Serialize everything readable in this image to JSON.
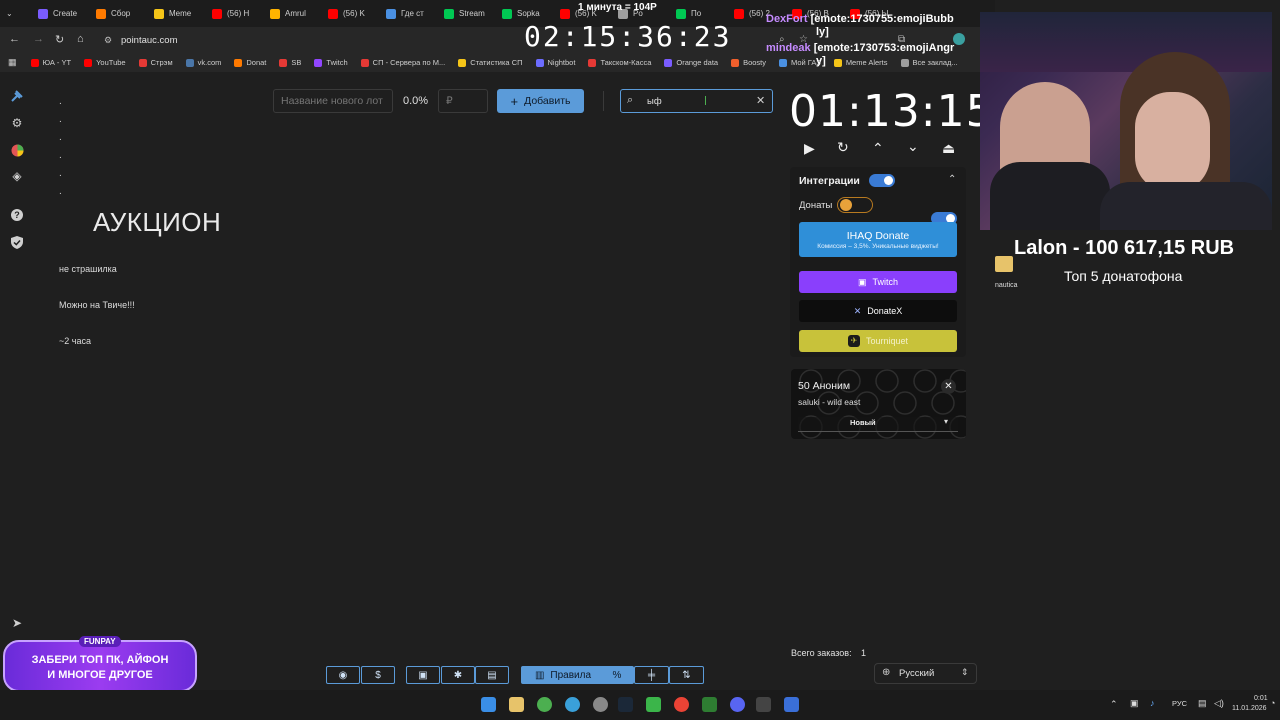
{
  "browser": {
    "tabs": [
      {
        "label": "Create",
        "color": "#7a5cff"
      },
      {
        "label": "Сбор",
        "color": "#ff7a00"
      },
      {
        "label": "Meme",
        "color": "#f5c518"
      },
      {
        "label": "(56) H",
        "color": "#ff0000"
      },
      {
        "label": "Amrul",
        "color": "#ffb300"
      },
      {
        "label": "(56) K",
        "color": "#ff0000"
      },
      {
        "label": "Где ст",
        "color": "#4a90e2"
      },
      {
        "label": "Stream",
        "color": "#00c853"
      },
      {
        "label": "Sopka",
        "color": "#00c853"
      },
      {
        "label": "(56) K",
        "color": "#ff0000"
      },
      {
        "label": "Po",
        "color": "#9e9e9e"
      },
      {
        "label": "По",
        "color": "#00c853"
      },
      {
        "label": "(56) 2",
        "color": "#ff0000"
      },
      {
        "label": "(56) B",
        "color": "#ff0000"
      },
      {
        "label": "(56) Ы",
        "color": "#ff0000"
      }
    ],
    "url": "pointauc.com",
    "bookmarks": [
      {
        "label": "ЮА - YT",
        "color": "#ff0000"
      },
      {
        "label": "YouTube",
        "color": "#ff0000"
      },
      {
        "label": "Стрэм",
        "color": "#e53935"
      },
      {
        "label": "vk.com",
        "color": "#4a76a8"
      },
      {
        "label": "Donat",
        "color": "#ff7a00"
      },
      {
        "label": "SB",
        "color": "#e53935"
      },
      {
        "label": "Twitch",
        "color": "#9146ff"
      },
      {
        "label": "СП - Сервера по M...",
        "color": "#e53935"
      },
      {
        "label": "Статистика СП",
        "color": "#f5c518"
      },
      {
        "label": "Nightbot",
        "color": "#6c6cff"
      },
      {
        "label": "Такском-Касса",
        "color": "#e53935"
      },
      {
        "label": "Orange data",
        "color": "#7a5cff"
      },
      {
        "label": "Boosty",
        "color": "#f15f2c"
      },
      {
        "label": "Мой ГАЗ",
        "color": "#4a90e2"
      },
      {
        "label": "Meme Alerts",
        "color": "#f5c518"
      },
      {
        "label": "Все заклад...",
        "color": "#9e9e9e"
      }
    ]
  },
  "auction": {
    "new_lot_placeholder": "Название нового лот",
    "percent": "0.0%",
    "amount_placeholder": "₽",
    "add_label": "Добавить",
    "search_value": "ыф",
    "dots": [
      ".",
      ".",
      ".",
      ".",
      ".",
      "."
    ],
    "title": "АУКЦИОН",
    "notes": [
      "не страшилка",
      "Можно на  Твиче!!!",
      "~2 часа"
    ]
  },
  "timer": {
    "value": "01:13:15"
  },
  "integrations": {
    "title": "Интеграции",
    "donations_label": "Донаты",
    "providers": [
      {
        "name": "IHAQ Donate",
        "sub": "Комиссия – 3,5%. Уникальные виджеты!",
        "color": "#2f8fd8"
      },
      {
        "name": "Twitch",
        "color": "#8a3ffc"
      },
      {
        "name": "DonateX",
        "color": "#111111"
      },
      {
        "name": "Tourniquet",
        "color": "#c8c23a"
      }
    ]
  },
  "donation_card": {
    "title": "50 Аноним",
    "subtitle": "saluki - wild east",
    "status": "Новый"
  },
  "footer": {
    "orders_label": "Всего заказов:",
    "orders_count": "1",
    "language": "Русский",
    "toolbar_rules": "Правила"
  },
  "promo": {
    "badge": "FUNPAY",
    "line1": "ЗАБЕРИ ТОП ПК, АЙФОН",
    "line2": "И МНОГОЕ ДРУГОЕ"
  },
  "stream_overlay": {
    "top_text": "1 минута = 104Р",
    "stream_timer": "02:15:36:23",
    "chat": [
      {
        "user": "DexFort",
        "color": "#c58bff",
        "text": "[emote:1730755:emojiBubb"
      },
      {
        "user": "",
        "color": "#ffffff",
        "text": "ly]"
      },
      {
        "user": "mindeak",
        "color": "#c58bff",
        "text": "[emote:1730753:emojiAngr"
      },
      {
        "user": "",
        "color": "#ffffff",
        "text": "y]"
      }
    ],
    "top_donator": "Lalon - 100 617,15 RUB",
    "top_caption": "Топ  5 донатофона",
    "side_label": "nautica"
  },
  "taskbar": {
    "lang": "РУС",
    "time": "0:01",
    "date": "11.01.2026"
  }
}
